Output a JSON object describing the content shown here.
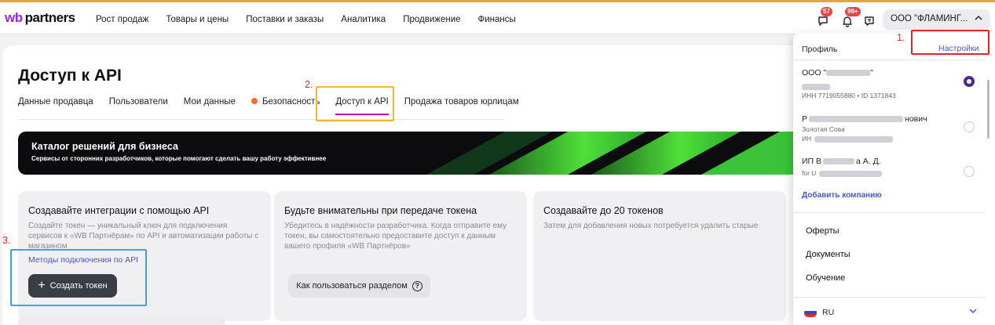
{
  "header": {
    "logo_wb": "wb",
    "logo_text": "partners",
    "nav": [
      "Рост продаж",
      "Товары и цены",
      "Поставки и заказы",
      "Аналитика",
      "Продвижение",
      "Финансы"
    ],
    "badges": {
      "chat": "57",
      "notifications": "99+"
    },
    "account_label": "ООО \"ФЛАМИНГ...",
    "account_chevron": "^",
    "icons": [
      "chat-icon",
      "bell-icon",
      "message-icon",
      "chevron-up-icon"
    ]
  },
  "page": {
    "title": "Доступ к API",
    "tabs": [
      {
        "label": "Данные продавца"
      },
      {
        "label": "Пользователи"
      },
      {
        "label": "Мои данные"
      },
      {
        "label": "Безопасность"
      },
      {
        "label": "Доступ к API"
      },
      {
        "label": "Продажа товаров юрлицам"
      }
    ],
    "active_tab": "Доступ к API",
    "banner": {
      "title": "Каталог решений для бизнеса",
      "subtitle": "Сервисы от сторонних разработчиков, которые помогают сделать вашу работу эффективнее"
    },
    "cards": [
      {
        "title": "Создавайте интеграции с помощью API",
        "text": "Создайте токен — уникальный ключ для подключения сервисов к «WB Партнёрам» по API и автоматизации работы с магазином",
        "link": "Методы подключения по API",
        "button": "Создать токен"
      },
      {
        "title": "Будьте внимательны при передаче токена",
        "text": "Убедитесь в надёжности разработчика. Когда отправите ему токен, вы самостоятельно предоставите доступ к данным вашего профиля «WB Партнёров»",
        "button": "Как пользоваться разделом"
      },
      {
        "title": "Создавайте до 20 токенов",
        "text": "Затем для добавления новых потребуется удалить старые"
      }
    ]
  },
  "annotations": {
    "step1": "1.",
    "step2": "2.",
    "step3": "3."
  },
  "dropdown": {
    "profile_label": "Профиль",
    "settings_link": "Настройки",
    "companies": [
      {
        "name_prefix": "ООО \"",
        "name_suffix": "\"",
        "sub": "ИНН 7719055880 • ID 1371843",
        "selected": true
      },
      {
        "name_prefix": "Р",
        "name_suffix": "нович",
        "sub_top": "Золотая Сова",
        "sub": "ИН",
        "selected": false
      },
      {
        "name_prefix": "ИП В",
        "name_suffix": "а А. Д.",
        "sub": "for U",
        "selected": false
      }
    ],
    "add_company": "Добавить компанию",
    "items": [
      "Оферты",
      "Документы",
      "Обучение"
    ],
    "language": "RU"
  },
  "colors": {
    "accent_purple": "#cb11ab",
    "link_blue": "#4a55cc",
    "annotation_red": "#d72b2b",
    "highlight_yellow": "#f2b733",
    "highlight_blue": "#3ea0e6",
    "badge_red": "#e64545",
    "security_dot": "#ff6b2b"
  }
}
